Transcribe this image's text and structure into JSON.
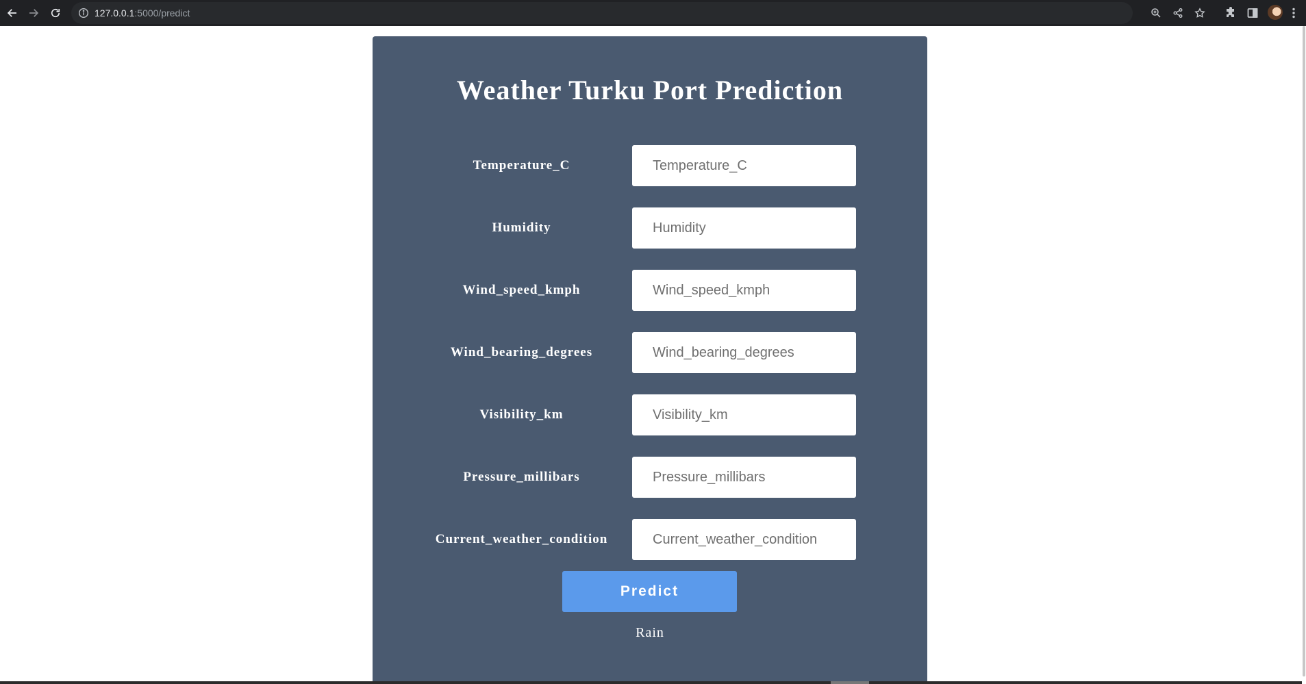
{
  "browser": {
    "url_host": "127.0.0.1",
    "url_rest": ":5000/predict"
  },
  "page": {
    "title": "Weather Turku Port Prediction",
    "fields": [
      {
        "label": "Temperature_C",
        "placeholder": "Temperature_C"
      },
      {
        "label": "Humidity",
        "placeholder": "Humidity"
      },
      {
        "label": "Wind_speed_kmph",
        "placeholder": "Wind_speed_kmph"
      },
      {
        "label": "Wind_bearing_degrees",
        "placeholder": "Wind_bearing_degrees"
      },
      {
        "label": "Visibility_km",
        "placeholder": "Visibility_km"
      },
      {
        "label": "Pressure_millibars",
        "placeholder": "Pressure_millibars"
      },
      {
        "label": "Current_weather_condition",
        "placeholder": "Current_weather_condition"
      }
    ],
    "predict_label": "Predict",
    "result": "Rain"
  },
  "colors": {
    "card_background": "#4a5a70",
    "button": "#5b9aeb",
    "browser_toolbar": "#202124"
  }
}
